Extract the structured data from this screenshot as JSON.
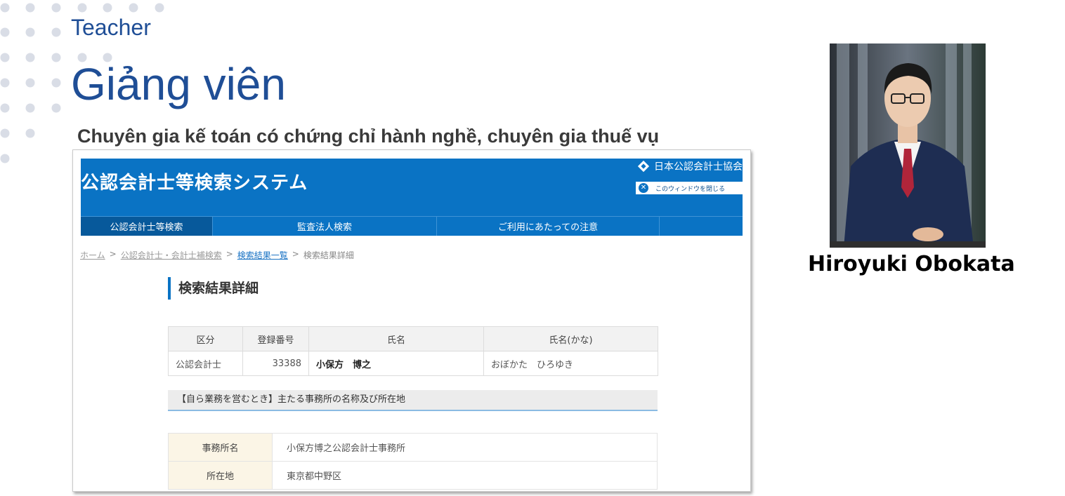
{
  "slide": {
    "label": "Teacher",
    "title": "Giảng viên",
    "subtitle": "Chuyên gia kế toán có chứng chỉ hành nghề, chuyên gia thuế vụ",
    "person_name": "Hiroyuki Obokata"
  },
  "colors": {
    "accent": "#1f4e96",
    "site_blue": "#0a73c4",
    "dot": "#d9dde6"
  },
  "site": {
    "title": "公認会計士等検索システム",
    "association": "日本公認会計士協会",
    "close_window": "このウィンドウを閉じる",
    "nav": [
      "公認会計士等検索",
      "監査法人検索",
      "ご利用にあたっての注意"
    ],
    "breadcrumb": {
      "home": "ホーム",
      "search": "公認会計士・会計士補検索",
      "results": "検索結果一覧",
      "current": "検索結果詳細",
      "separator": ">"
    },
    "heading": "検索結果詳細",
    "table": {
      "headers": [
        "区分",
        "登録番号",
        "氏名",
        "氏名(かな)"
      ],
      "row": {
        "category": "公認会計士",
        "reg_no": "33388",
        "name": "小保方　博之",
        "kana": "おぼかた　ひろゆき"
      }
    },
    "office_section": {
      "heading": "【自ら業務を営むとき】主たる事務所の名称及び所在地",
      "rows": [
        {
          "label": "事務所名",
          "value": "小保方博之公認会計士事務所"
        },
        {
          "label": "所在地",
          "value": "東京都中野区"
        }
      ]
    }
  }
}
